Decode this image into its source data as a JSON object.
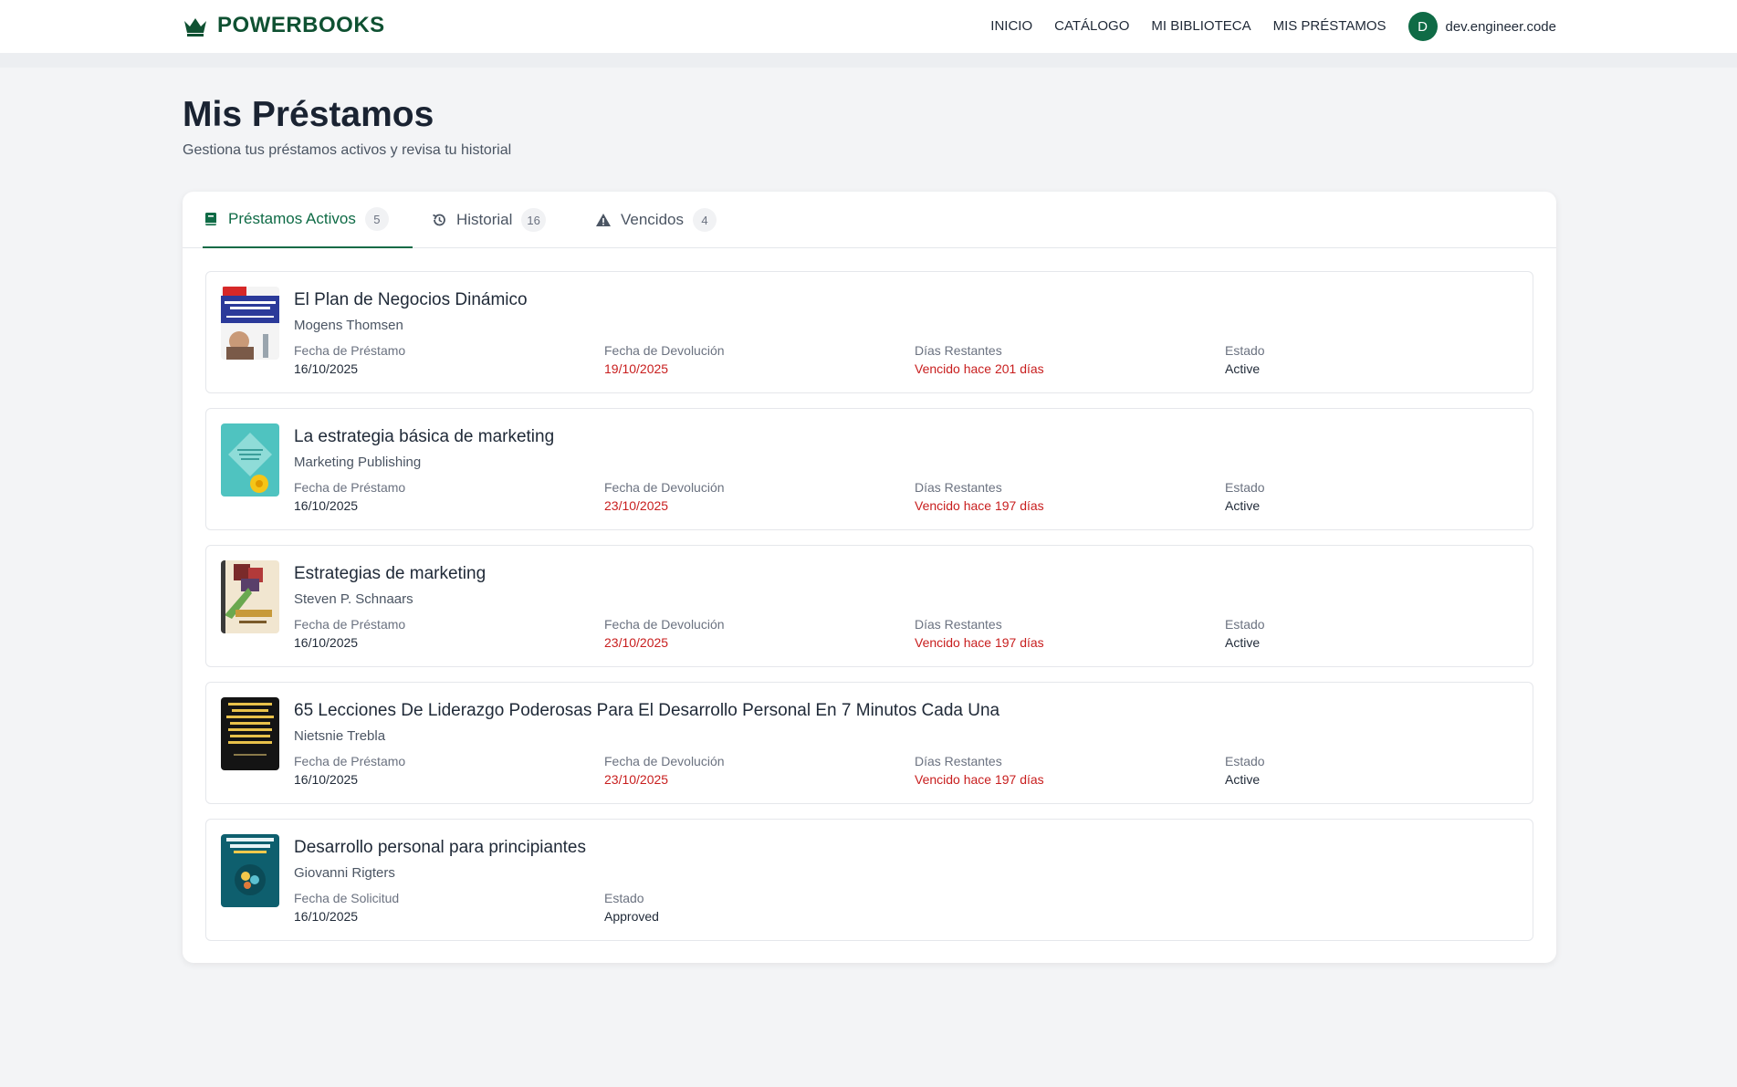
{
  "brand": {
    "name": "POWERBOOKS",
    "icon": "crown-icon",
    "color": "#0f5132"
  },
  "nav": {
    "links": [
      "INICIO",
      "CATÁLOGO",
      "MI BIBLIOTECA",
      "MIS PRÉSTAMOS"
    ],
    "user": {
      "initial": "D",
      "name": "dev.engineer.code"
    }
  },
  "page": {
    "title": "Mis Préstamos",
    "subtitle": "Gestiona tus préstamos activos y revisa tu historial"
  },
  "tabs": [
    {
      "label": "Préstamos Activos",
      "count": "5",
      "icon": "book-icon",
      "active": true
    },
    {
      "label": "Historial",
      "count": "16",
      "icon": "history-icon",
      "active": false
    },
    {
      "label": "Vencidos",
      "count": "4",
      "icon": "warning-icon",
      "active": false
    }
  ],
  "loans": [
    {
      "title": "El Plan de Negocios Dinámico",
      "author": "Mogens Thomsen",
      "fields": [
        {
          "label": "Fecha de Préstamo",
          "value": "16/10/2025"
        },
        {
          "label": "Fecha de Devolución",
          "value": "19/10/2025"
        },
        {
          "label": "Días Restantes",
          "value": "Vencido hace 201 días"
        },
        {
          "label": "Estado",
          "value": "Active"
        }
      ]
    },
    {
      "title": "La estrategia básica de marketing",
      "author": "Marketing Publishing",
      "fields": [
        {
          "label": "Fecha de Préstamo",
          "value": "16/10/2025"
        },
        {
          "label": "Fecha de Devolución",
          "value": "23/10/2025"
        },
        {
          "label": "Días Restantes",
          "value": "Vencido hace 197 días"
        },
        {
          "label": "Estado",
          "value": "Active"
        }
      ]
    },
    {
      "title": "Estrategias de marketing",
      "author": "Steven P. Schnaars",
      "fields": [
        {
          "label": "Fecha de Préstamo",
          "value": "16/10/2025"
        },
        {
          "label": "Fecha de Devolución",
          "value": "23/10/2025"
        },
        {
          "label": "Días Restantes",
          "value": "Vencido hace 197 días"
        },
        {
          "label": "Estado",
          "value": "Active"
        }
      ]
    },
    {
      "title": "65 Lecciones De Liderazgo Poderosas Para El Desarrollo Personal En 7 Minutos Cada Una",
      "author": "Nietsnie Trebla",
      "fields": [
        {
          "label": "Fecha de Préstamo",
          "value": "16/10/2025"
        },
        {
          "label": "Fecha de Devolución",
          "value": "23/10/2025"
        },
        {
          "label": "Días Restantes",
          "value": "Vencido hace 197 días"
        },
        {
          "label": "Estado",
          "value": "Active"
        }
      ]
    },
    {
      "title": "Desarrollo personal para principiantes",
      "author": "Giovanni Rigters",
      "fields": [
        {
          "label": "Fecha de Solicitud",
          "value": "16/10/2025"
        },
        {
          "label": "Estado",
          "value": "Approved"
        }
      ]
    }
  ],
  "colors": {
    "accent": "#0f6b46",
    "overdue": "#c81e1e"
  }
}
